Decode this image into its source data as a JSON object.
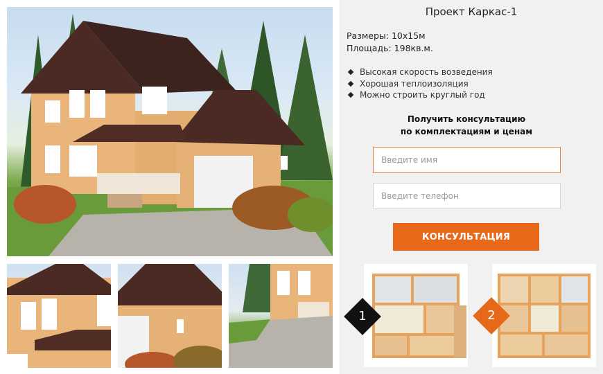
{
  "project": {
    "title": "Проект Каркас-1",
    "size": "Размеры: 10х15м",
    "area": "Площадь: 198кв.м."
  },
  "features": [
    "Высокая скорость возведения",
    "Хорошая теплоизоляция",
    "Можно строить круглый год"
  ],
  "consult": {
    "line1": "Получить консультацию",
    "line2": "по комплектациям и ценам",
    "name_placeholder": "Введите имя",
    "phone_placeholder": "Введите телефон",
    "button_label": "КОНСУЛЬТАЦИЯ"
  },
  "plans": [
    {
      "number": "1"
    },
    {
      "number": "2"
    }
  ],
  "colors": {
    "accent": "#e8681a",
    "roof": "#4a2a22",
    "wall": "#e9b57a",
    "panel_bg": "#f1f1f1"
  },
  "icons": {
    "bullet": "diamond-bullet-icon"
  }
}
